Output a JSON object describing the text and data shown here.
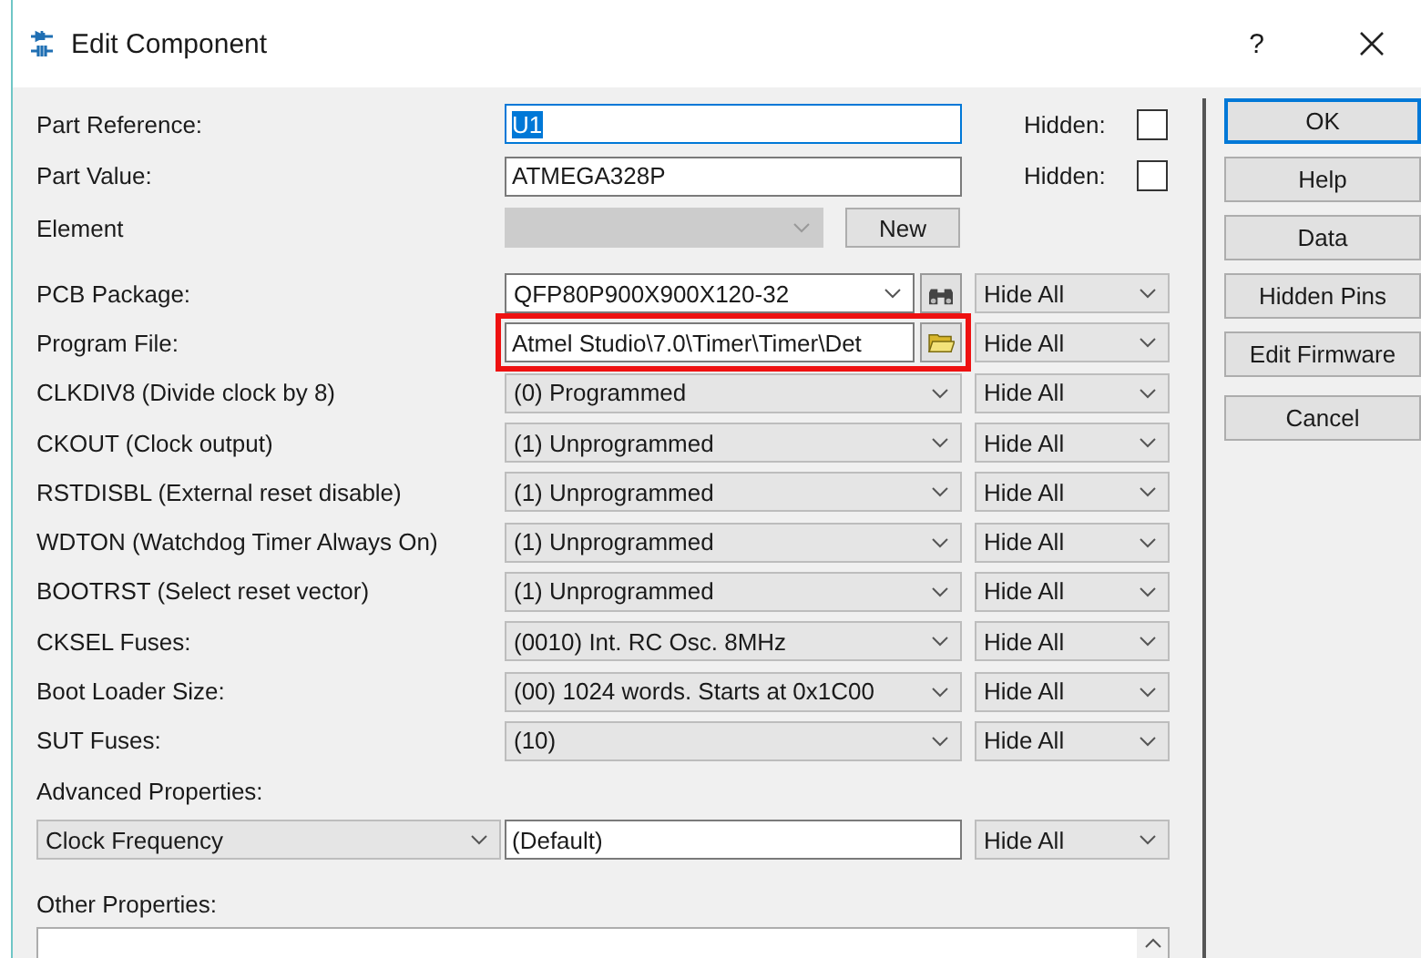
{
  "window": {
    "title": "Edit Component",
    "help": "?"
  },
  "properties": [
    {
      "kind": "text",
      "label": "Part Reference:",
      "value": "U1",
      "focused": true,
      "hidden_label": "Hidden:",
      "hidden": false
    },
    {
      "kind": "text",
      "label": "Part Value:",
      "value": "ATMEGA328P",
      "focused": false,
      "hidden_label": "Hidden:",
      "hidden": false
    },
    {
      "kind": "element",
      "label": "Element",
      "disabled": true,
      "button": "New"
    },
    {
      "kind": "package",
      "label": "PCB Package:",
      "value": "QFP80P900X900X120-32",
      "visibility": "Hide All"
    },
    {
      "kind": "file",
      "label": "Program File:",
      "value": "Atmel Studio\\7.0\\Timer\\Timer\\Det",
      "outlined": true,
      "visibility": "Hide All"
    },
    {
      "kind": "fuse",
      "label": "CLKDIV8 (Divide clock by 8)",
      "value": "(0) Programmed",
      "visibility": "Hide All"
    },
    {
      "kind": "fuse",
      "label": "CKOUT (Clock output)",
      "value": "(1) Unprogrammed",
      "visibility": "Hide All"
    },
    {
      "kind": "fuse",
      "label": "RSTDISBL (External reset disable)",
      "value": "(1) Unprogrammed",
      "visibility": "Hide All"
    },
    {
      "kind": "fuse",
      "label": "WDTON (Watchdog Timer Always On)",
      "value": "(1) Unprogrammed",
      "visibility": "Hide All"
    },
    {
      "kind": "fuse",
      "label": "BOOTRST (Select reset vector)",
      "value": "(1) Unprogrammed",
      "visibility": "Hide All"
    },
    {
      "kind": "fuse",
      "label": "CKSEL Fuses:",
      "value": "(0010) Int. RC Osc. 8MHz",
      "visibility": "Hide All"
    },
    {
      "kind": "fuse",
      "label": "Boot Loader Size:",
      "value": "(00) 1024 words. Starts at 0x1C00",
      "visibility": "Hide All"
    },
    {
      "kind": "fuse",
      "label": "SUT Fuses:",
      "value": "(10)",
      "visibility": "Hide All"
    }
  ],
  "advanced": {
    "label": "Advanced Properties:",
    "property": "Clock Frequency",
    "value": "(Default)",
    "visibility": "Hide All"
  },
  "other": {
    "label": "Other Properties:"
  },
  "buttons": [
    {
      "label": "OK",
      "default": true
    },
    {
      "label": "Help",
      "default": false
    },
    {
      "label": "Data",
      "default": false
    },
    {
      "label": "Hidden Pins",
      "default": false
    },
    {
      "label": "Edit Firmware",
      "default": false
    },
    {
      "label": "Cancel",
      "default": false
    }
  ]
}
